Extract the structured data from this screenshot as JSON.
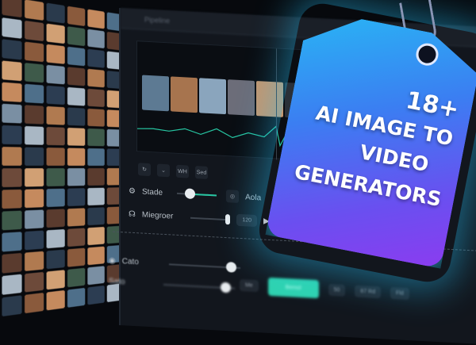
{
  "editor": {
    "title": "Pipeline"
  },
  "toolbar": {
    "t1": "↻",
    "t2": "⌄",
    "t3": "WH",
    "t4": "Sed"
  },
  "controls": {
    "stade": "Stade",
    "aola": "Aola",
    "miegroer": "Miegroer",
    "readout": "120",
    "cato": "Cato",
    "sato": "Sato",
    "menu": "Me",
    "apply": "Bemol",
    "b1": "50",
    "b2": "87 Rd",
    "b3": "Fld"
  },
  "sliders": {
    "stade": 0.2,
    "miegroer": 0.9
  },
  "tag": {
    "line1": "18+",
    "line2": "AI IMAGE TO",
    "line3": "VIDEO",
    "line4": "GENERATORS"
  },
  "colors": {
    "accent": "#2fd3b0",
    "tag_top": "#28b7f4",
    "tag_bottom": "#8b3cf0"
  }
}
